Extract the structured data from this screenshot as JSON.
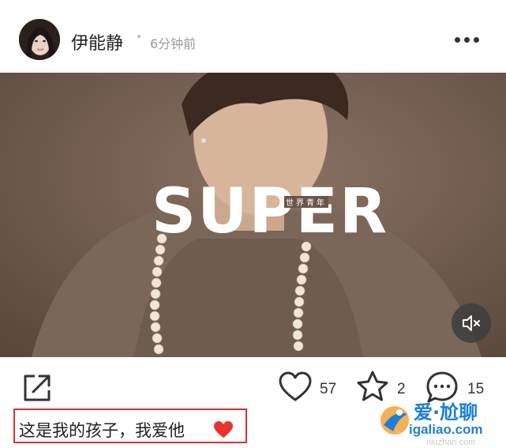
{
  "post": {
    "author": "伊能静",
    "time": "6分钟前",
    "caption": "这是我的孩子，我爱他",
    "caption_emoji_icon": "red-heart-icon"
  },
  "video": {
    "brand": "SUPER",
    "brand_sub": "世界青年"
  },
  "actions": {
    "likes": "57",
    "favorites": "2",
    "comments": "15",
    "share_icon": "share-icon",
    "like_icon": "heart-outline-icon",
    "favorite_icon": "star-outline-icon",
    "comment_icon": "comment-bubble-icon"
  },
  "watermark": {
    "title": "爱·尬聊",
    "url": "igaliao.com",
    "sub": "niuzhan.com"
  },
  "colors": {
    "highlight_border": "#e0302b",
    "watermark_blue": "#1e7fd6"
  }
}
